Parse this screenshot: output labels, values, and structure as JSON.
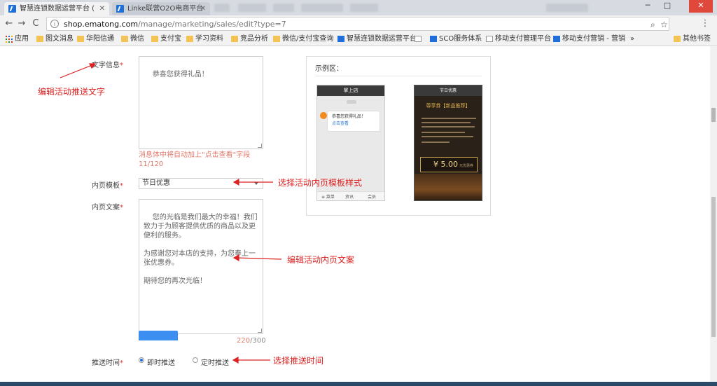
{
  "browser": {
    "tabs": [
      {
        "title": "智慧连锁数据运营平台 (",
        "active": true
      },
      {
        "title": "Linke联营O2O电商平台",
        "active": false
      }
    ],
    "url_host": "shop.ematong.com",
    "url_path": "/manage/marketing/sales/edit?type=7",
    "window_controls": {
      "minimize": "─",
      "maximize": "□",
      "close": "✕"
    },
    "nav": {
      "back": "←",
      "forward": "→",
      "reload": "C"
    }
  },
  "bookmarks": [
    {
      "label": "应用",
      "icon": "apps-icon"
    },
    {
      "label": "图文消息",
      "icon": "folder-icon"
    },
    {
      "label": "华阳信通",
      "icon": "folder-icon"
    },
    {
      "label": "微信",
      "icon": "folder-icon"
    },
    {
      "label": "支付宝",
      "icon": "folder-icon"
    },
    {
      "label": "学习资料",
      "icon": "folder-icon"
    },
    {
      "label": "竞品分析",
      "icon": "folder-icon"
    },
    {
      "label": "微信/支付宝查询",
      "icon": "folder-icon"
    },
    {
      "label": "智慧连锁数据运营平台",
      "icon": "brand-icon"
    },
    {
      "label": "",
      "icon": "page-icon"
    },
    {
      "label": "SCO服务体系",
      "icon": "blue-icon"
    },
    {
      "label": "移动支付管理平台",
      "icon": "page-icon"
    },
    {
      "label": "移动支付营销 - 营销",
      "icon": "blue-icon"
    },
    {
      "label": "其他书签",
      "icon": "folder-icon"
    }
  ],
  "form": {
    "text_info_label": "文字信息",
    "text_info_value": "恭喜您获得礼品！",
    "text_info_hint": "消息体中将自动加上\"点击查看\"字段",
    "text_info_count": "11/120",
    "template_label": "内页模板",
    "template_value": "节日优惠",
    "body_label": "内页文案",
    "body_value": "您的光临是我们最大的幸福！我们致力于为顾客提供优质的商品以及更便利的服务。\n\n为感谢您对本店的支持，为您奉上一张优惠券。\n\n期待您的再次光临！",
    "body_count_current": "220",
    "body_count_max": "/300",
    "push_time_label": "推送时间",
    "push_now": "即时推送",
    "push_scheduled": "定时推送"
  },
  "preview": {
    "title": "示例区：",
    "phone1": {
      "header": "掌上店",
      "message": "恭喜您获得礼品！",
      "link": "点击查看",
      "footer": [
        "≡ 菜单",
        "资讯",
        "会员"
      ]
    },
    "phone2": {
      "header": "节日优惠",
      "heading": "尊享券【新品推荐】",
      "coupon_amount": "¥ 5.00",
      "coupon_unit": "元优惠券"
    }
  },
  "annotations": {
    "edit_text": "编辑活动推送文字",
    "choose_template": "选择活动内页模板样式",
    "edit_body": "编辑活动内页文案",
    "choose_time": "选择推送时间"
  },
  "colors": {
    "annotation": "#dd2222",
    "accent": "#1e6fd9",
    "hint": "#e07b6c"
  }
}
